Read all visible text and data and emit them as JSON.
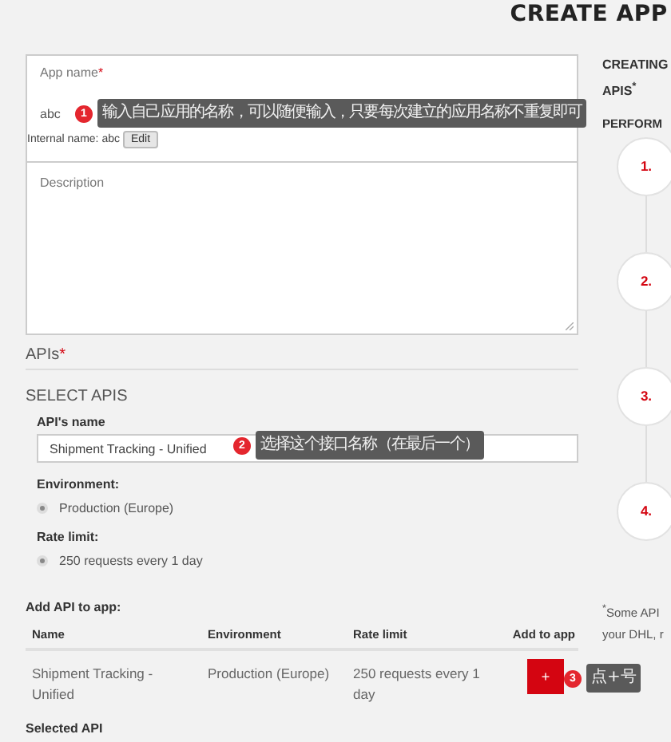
{
  "page_title": "CREATE APP",
  "app_name": {
    "label": "App name",
    "required_mark": "*",
    "value": "abc",
    "internal_name_label": "Internal name: abc",
    "edit_button": "Edit"
  },
  "description": {
    "label": "Description"
  },
  "apis": {
    "heading": "APIs",
    "required_mark": "*",
    "select_heading": "SELECT APIS",
    "name_label": "API's name",
    "name_value": "Shipment Tracking - Unified",
    "environment_label": "Environment:",
    "environment_options": [
      {
        "label": "Production (Europe)",
        "selected": true
      }
    ],
    "rate_label": "Rate limit:",
    "rate_options": [
      {
        "label": "250 requests every 1 day",
        "selected": true
      }
    ]
  },
  "add_api": {
    "heading": "Add API to app:",
    "columns": [
      "Name",
      "Environment",
      "Rate limit",
      "Add to app"
    ],
    "rows": [
      {
        "name": "Shipment Tracking - Unified",
        "environment": "Production (Europe)",
        "rate_limit": "250 requests every 1 day",
        "add_button": "+"
      }
    ]
  },
  "selected_api_heading": "Selected API",
  "annotations": [
    {
      "number": "1",
      "text": "输入自己应用的名称，可以随便输入，只要每次建立的应用名称不重复即可"
    },
    {
      "number": "2",
      "text": "选择这个接口名称（在最后一个）"
    },
    {
      "number": "3",
      "text": "点+号"
    }
  ],
  "sidebar": {
    "heading": "CREATING APIS",
    "heading_mark": "*",
    "subheading": "PERFORM",
    "steps": [
      "1.",
      "2.",
      "3.",
      "4."
    ],
    "footnote_mark": "*",
    "footnote_lines": [
      "Some API",
      "your DHL, r"
    ]
  }
}
